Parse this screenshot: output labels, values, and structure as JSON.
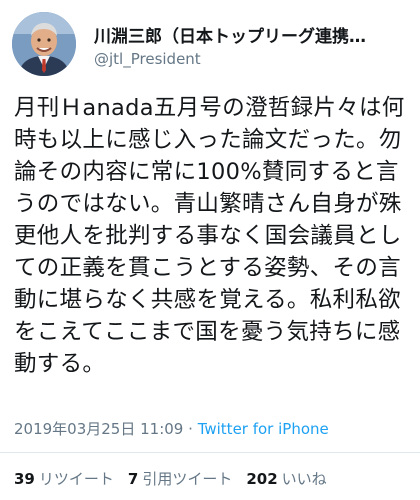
{
  "tweet": {
    "author": {
      "display_name": "川淵三郎（日本トップリーグ連携…",
      "handle": "@jtl_President"
    },
    "text": "月刊Ｈanada五月号の澄哲録片々は何時も以上に感じ入った論文だった。勿論その内容に常に100%賛同すると言うのではない。青山繁晴さん自身が殊更他人を批判する事なく国会議員としての正義を貫こうとする姿勢、その言動に堪らなく共感を覚える。私利私欲をこえてここまで国を憂う気持ちに感動する。",
    "timestamp": "2019年03月25日 11:09",
    "separator": "·",
    "source": "Twitter for iPhone",
    "stats": {
      "retweets_count": "39",
      "retweets_label": "リツイート",
      "quotes_count": "7",
      "quotes_label": "引用ツイート",
      "likes_count": "202",
      "likes_label": "いいね"
    }
  }
}
